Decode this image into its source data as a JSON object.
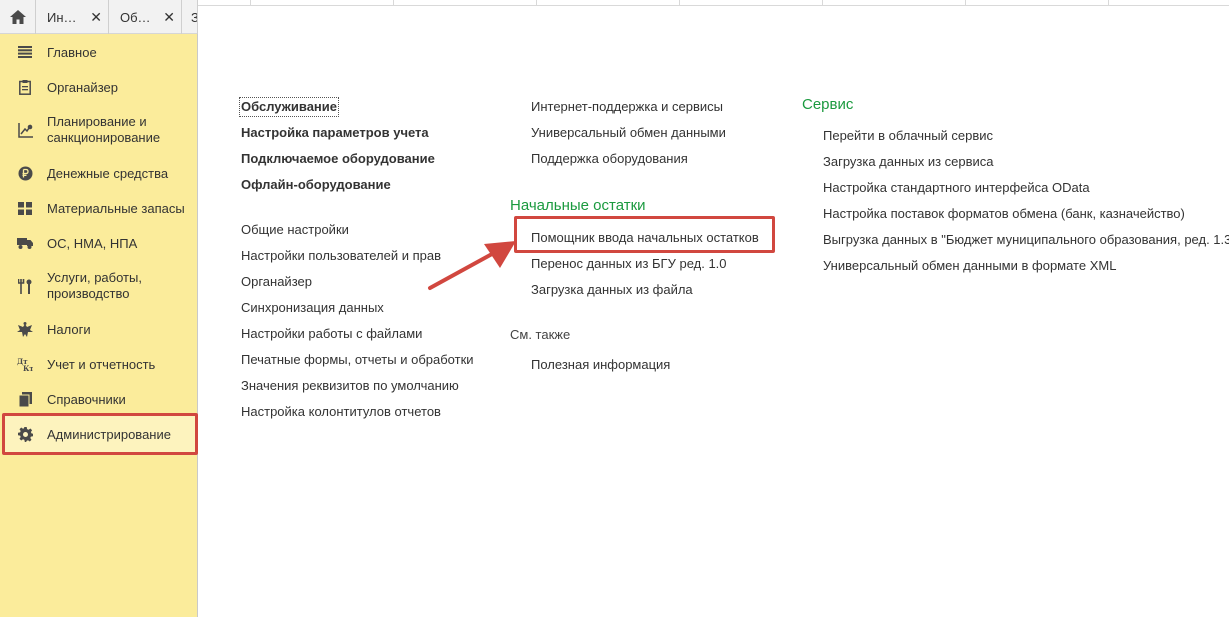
{
  "tabs": [
    {
      "label": "Ин…",
      "close": "✕"
    },
    {
      "label": "Об…",
      "close": "✕"
    },
    {
      "label": "З"
    }
  ],
  "sidebar": {
    "items": [
      {
        "label": "Главное",
        "icon": "menu-lines-icon"
      },
      {
        "label": "Органайзер",
        "icon": "clipboard-icon"
      },
      {
        "label": "Планирование и\nсанкционирование",
        "icon": "planning-chart-icon"
      },
      {
        "label": "Денежные средства",
        "icon": "ruble-icon"
      },
      {
        "label": "Материальные запасы",
        "icon": "grid-blocks-icon"
      },
      {
        "label": "ОС, НМА, НПА",
        "icon": "truck-icon"
      },
      {
        "label": "Услуги, работы,\nпроизводство",
        "icon": "tools-icon"
      },
      {
        "label": "Налоги",
        "icon": "eagle-emblem-icon"
      },
      {
        "label": "Учет и отчетность",
        "icon": "debit-credit-icon"
      },
      {
        "label": "Справочники",
        "icon": "books-icon"
      },
      {
        "label": "Администрирование",
        "icon": "gear-icon",
        "active": true
      }
    ]
  },
  "content": {
    "col1_bold": [
      "Обслуживание",
      "Настройка параметров учета",
      "Подключаемое оборудование",
      "Офлайн-оборудование"
    ],
    "col1_links": [
      "Общие настройки",
      "Настройки пользователей и прав",
      "Органайзер",
      "Синхронизация данных",
      "Настройки работы с файлами",
      "Печатные формы, отчеты и обработки",
      "Значения реквизитов по умолчанию",
      "Настройка колонтитулов отчетов"
    ],
    "col2_links": [
      "Интернет-поддержка и сервисы",
      "Универсальный обмен данными",
      "Поддержка оборудования"
    ],
    "initial_balances": {
      "title": "Начальные остатки",
      "links": [
        "Помощник ввода начальных остатков",
        "Перенос данных из БГУ ред. 1.0",
        "Загрузка данных из файла"
      ]
    },
    "see_also": {
      "title": "См. также",
      "links": [
        "Полезная информация"
      ]
    },
    "service": {
      "title": "Сервис",
      "links": [
        "Перейти в облачный сервис",
        "Загрузка данных из сервиса",
        "Настройка стандартного интерфейса OData",
        "Настройка поставок форматов обмена (банк, казначейство)",
        "Выгрузка данных в \"Бюджет муниципального образования, ред. 1.3",
        "Универсальный обмен данными в формате XML"
      ]
    }
  },
  "colors": {
    "sidebar_bg": "#fbec9b",
    "highlight_red": "#d1473f",
    "group_title_green": "#1b9a3f"
  }
}
